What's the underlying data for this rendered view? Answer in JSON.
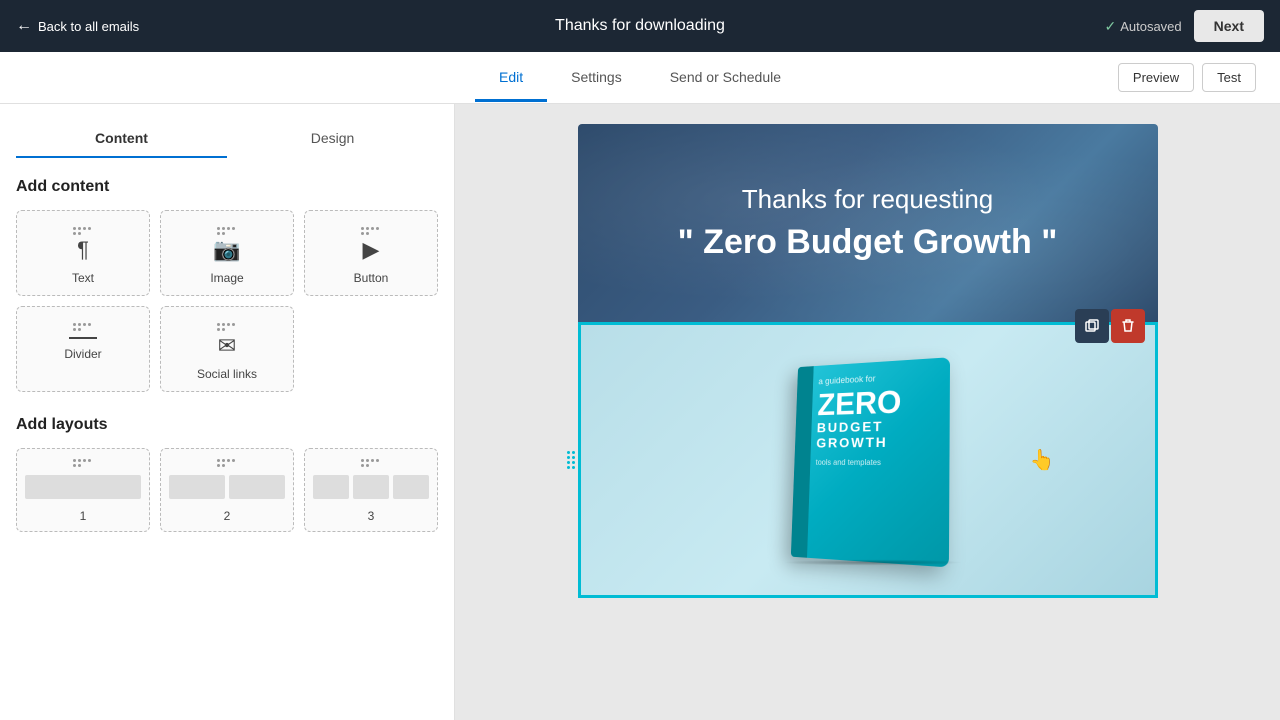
{
  "topnav": {
    "back_label": "Back to all emails",
    "doc_title": "Thanks for downloading",
    "autosaved_label": "Autosaved",
    "next_label": "Next"
  },
  "tabs": {
    "edit_label": "Edit",
    "settings_label": "Settings",
    "send_schedule_label": "Send or Schedule",
    "preview_label": "Preview",
    "test_label": "Test"
  },
  "sidebar": {
    "content_tab": "Content",
    "design_tab": "Design",
    "add_content_title": "Add content",
    "add_layouts_title": "Add layouts",
    "content_items": [
      {
        "label": "Text",
        "icon": "text"
      },
      {
        "label": "Image",
        "icon": "image"
      },
      {
        "label": "Button",
        "icon": "button"
      },
      {
        "label": "Divider",
        "icon": "divider"
      },
      {
        "label": "Social links",
        "icon": "social"
      }
    ],
    "layout_items": [
      {
        "label": "1",
        "cols": 1
      },
      {
        "label": "2",
        "cols": 2
      },
      {
        "label": "3",
        "cols": 3
      }
    ]
  },
  "email": {
    "header_thanks": "Thanks for requesting",
    "header_title": "\" Zero Budget Growth \"",
    "book_subtitle": "a guidebook for",
    "book_zero": "ZERO",
    "book_budget": "BUDGET GROWTH",
    "book_tools": "tools and templates"
  }
}
